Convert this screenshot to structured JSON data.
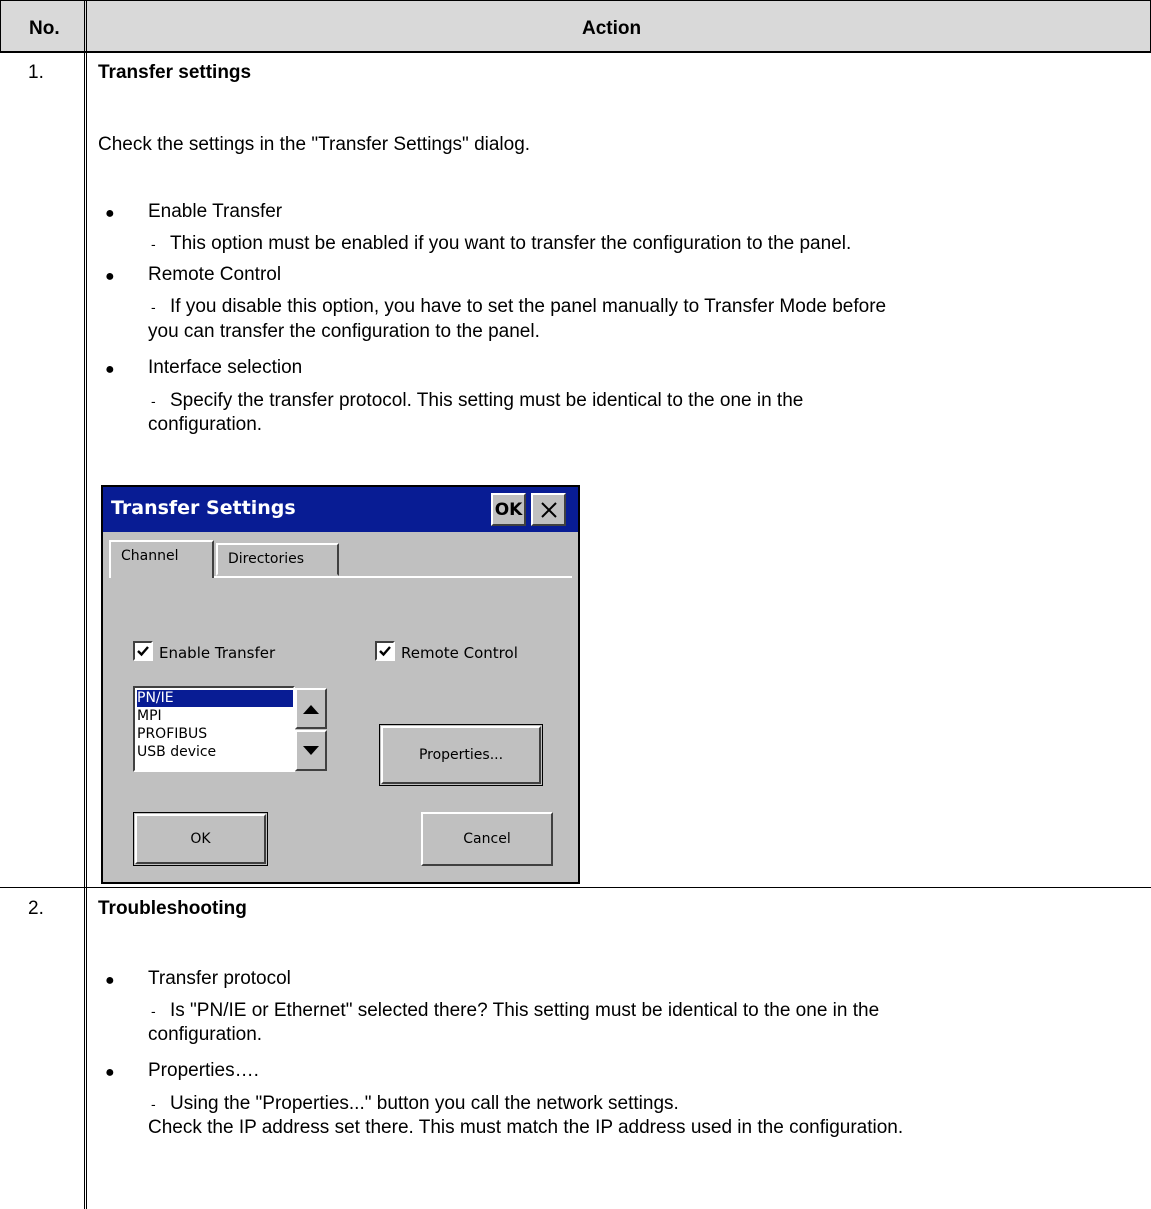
{
  "table": {
    "col_no": "No.",
    "col_action": "Action"
  },
  "steps": [
    {
      "number": "1.",
      "title": "Transfer settings",
      "intro": "Check the settings in the \"Transfer Settings\" dialog.",
      "items": [
        {
          "label": "Enable Transfer",
          "details": [
            "This option must be enabled if you want to transfer the configuration to the panel."
          ]
        },
        {
          "label": "Remote Control",
          "details": [
            "If you disable this option, you have to set the panel manually to Transfer Mode before",
            "you can transfer the configuration to the panel."
          ]
        },
        {
          "label": "Interface selection",
          "details": [
            "Specify the transfer protocol. This setting must be identical to the one in the",
            "configuration."
          ]
        }
      ]
    },
    {
      "number": "2.",
      "title": "Troubleshooting",
      "items": [
        {
          "label": "Transfer protocol",
          "details": [
            "Is \"PN/IE or Ethernet\" selected there? This setting must be identical to the one in the",
            "configuration."
          ]
        },
        {
          "label": "Properties….",
          "details": [
            "Using the \"Properties...\" button you call the network settings.",
            "Check the IP address set there. This must match the IP address used in the configuration."
          ]
        }
      ]
    }
  ],
  "dialog": {
    "title": "Transfer Settings",
    "title_ok": "OK",
    "title_close_icon": "close-icon",
    "tabs": [
      "Channel",
      "Directories"
    ],
    "active_tab": "Channel",
    "enable_transfer": {
      "label": "Enable Transfer",
      "checked": true
    },
    "remote_control": {
      "label": "Remote Control",
      "checked": true
    },
    "interfaces": [
      "PN/IE",
      "MPI",
      "PROFIBUS",
      "USB device"
    ],
    "selected_interface": "PN/IE",
    "properties_button": "Properties...",
    "ok_button": "OK",
    "cancel_button": "Cancel",
    "colors": {
      "title_bar": "#081c94",
      "face": "#c0c0c0",
      "selection": "#081c94"
    }
  }
}
